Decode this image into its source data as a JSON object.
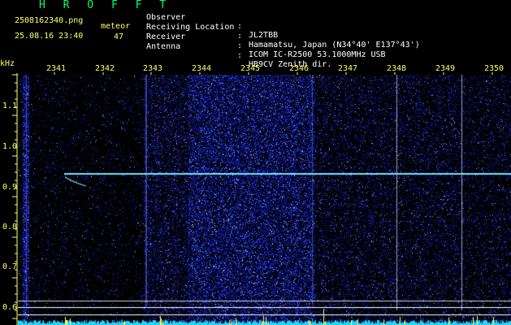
{
  "header": {
    "brand": "H R O F F T",
    "filename": "2508162340.png",
    "datetime": "25.08.16 23:40",
    "meteor_label": "meteor",
    "meteor_count": "47"
  },
  "info": [
    {
      "label": "Observer",
      "sep": ":",
      "value": "JL2TBB"
    },
    {
      "label": "Receiving Location",
      "sep": ":",
      "value": "Hamamatsu, Japan (N34°40' E137°43')"
    },
    {
      "label": "Receiver",
      "sep": ":",
      "value": "ICOM IC-R2500 53.1000MHz USB"
    },
    {
      "label": "Antenna",
      "sep": ":",
      "value": "HB9CV Zenith dir."
    }
  ],
  "spectrogram": {
    "unit_label": "kHz",
    "y_ticks": [
      "1.1",
      "1.0",
      "0.9",
      "0.8",
      "0.7",
      "0.6"
    ],
    "x_ticks": [
      "2341",
      "2342",
      "2343",
      "2344",
      "2345",
      "2346",
      "2347",
      "2348",
      "2349",
      "2350"
    ],
    "colors": {
      "label": "#ffff66",
      "signal": "#6fe0ff",
      "noise": "#1a2bd6",
      "baseline": "#22d3ff"
    }
  }
}
